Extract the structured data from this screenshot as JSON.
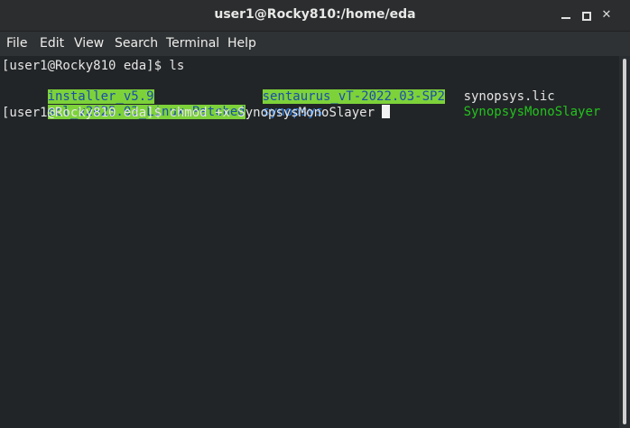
{
  "window": {
    "title": "user1@Rocky810:/home/eda",
    "minimize_glyph": "",
    "maximize_glyph": "",
    "close_glyph": "✕"
  },
  "menu": [
    "File",
    "Edit",
    "View",
    "Search",
    "Terminal",
    "Help"
  ],
  "terminal": {
    "line1": "[user1@Rocky810 eda]$ ls",
    "ls": {
      "col1": [
        "installer_v5.9",
        "scl_v2025.03_Linux.Patched"
      ],
      "col2": [
        "sentaurus_vT-2022.03-SP2",
        "synopsys"
      ],
      "col3": [
        "synopsys.lic",
        "SynopsysMonoSlayer"
      ]
    },
    "prompt": "[user1@Rocky810 eda]$ ",
    "command": "chmod +x SynopsysMonoSlayer "
  },
  "colors": {
    "highlight_bg": "#7dd23a",
    "highlight_fg": "#1a4fa8",
    "directory_blue": "#2f7de0",
    "executable_green": "#22c21e",
    "text": "#e5e5e5",
    "terminal_bg": "#222527"
  },
  "icons": {
    "minimize": "minimize-icon",
    "maximize": "maximize-icon",
    "close": "close-icon"
  }
}
